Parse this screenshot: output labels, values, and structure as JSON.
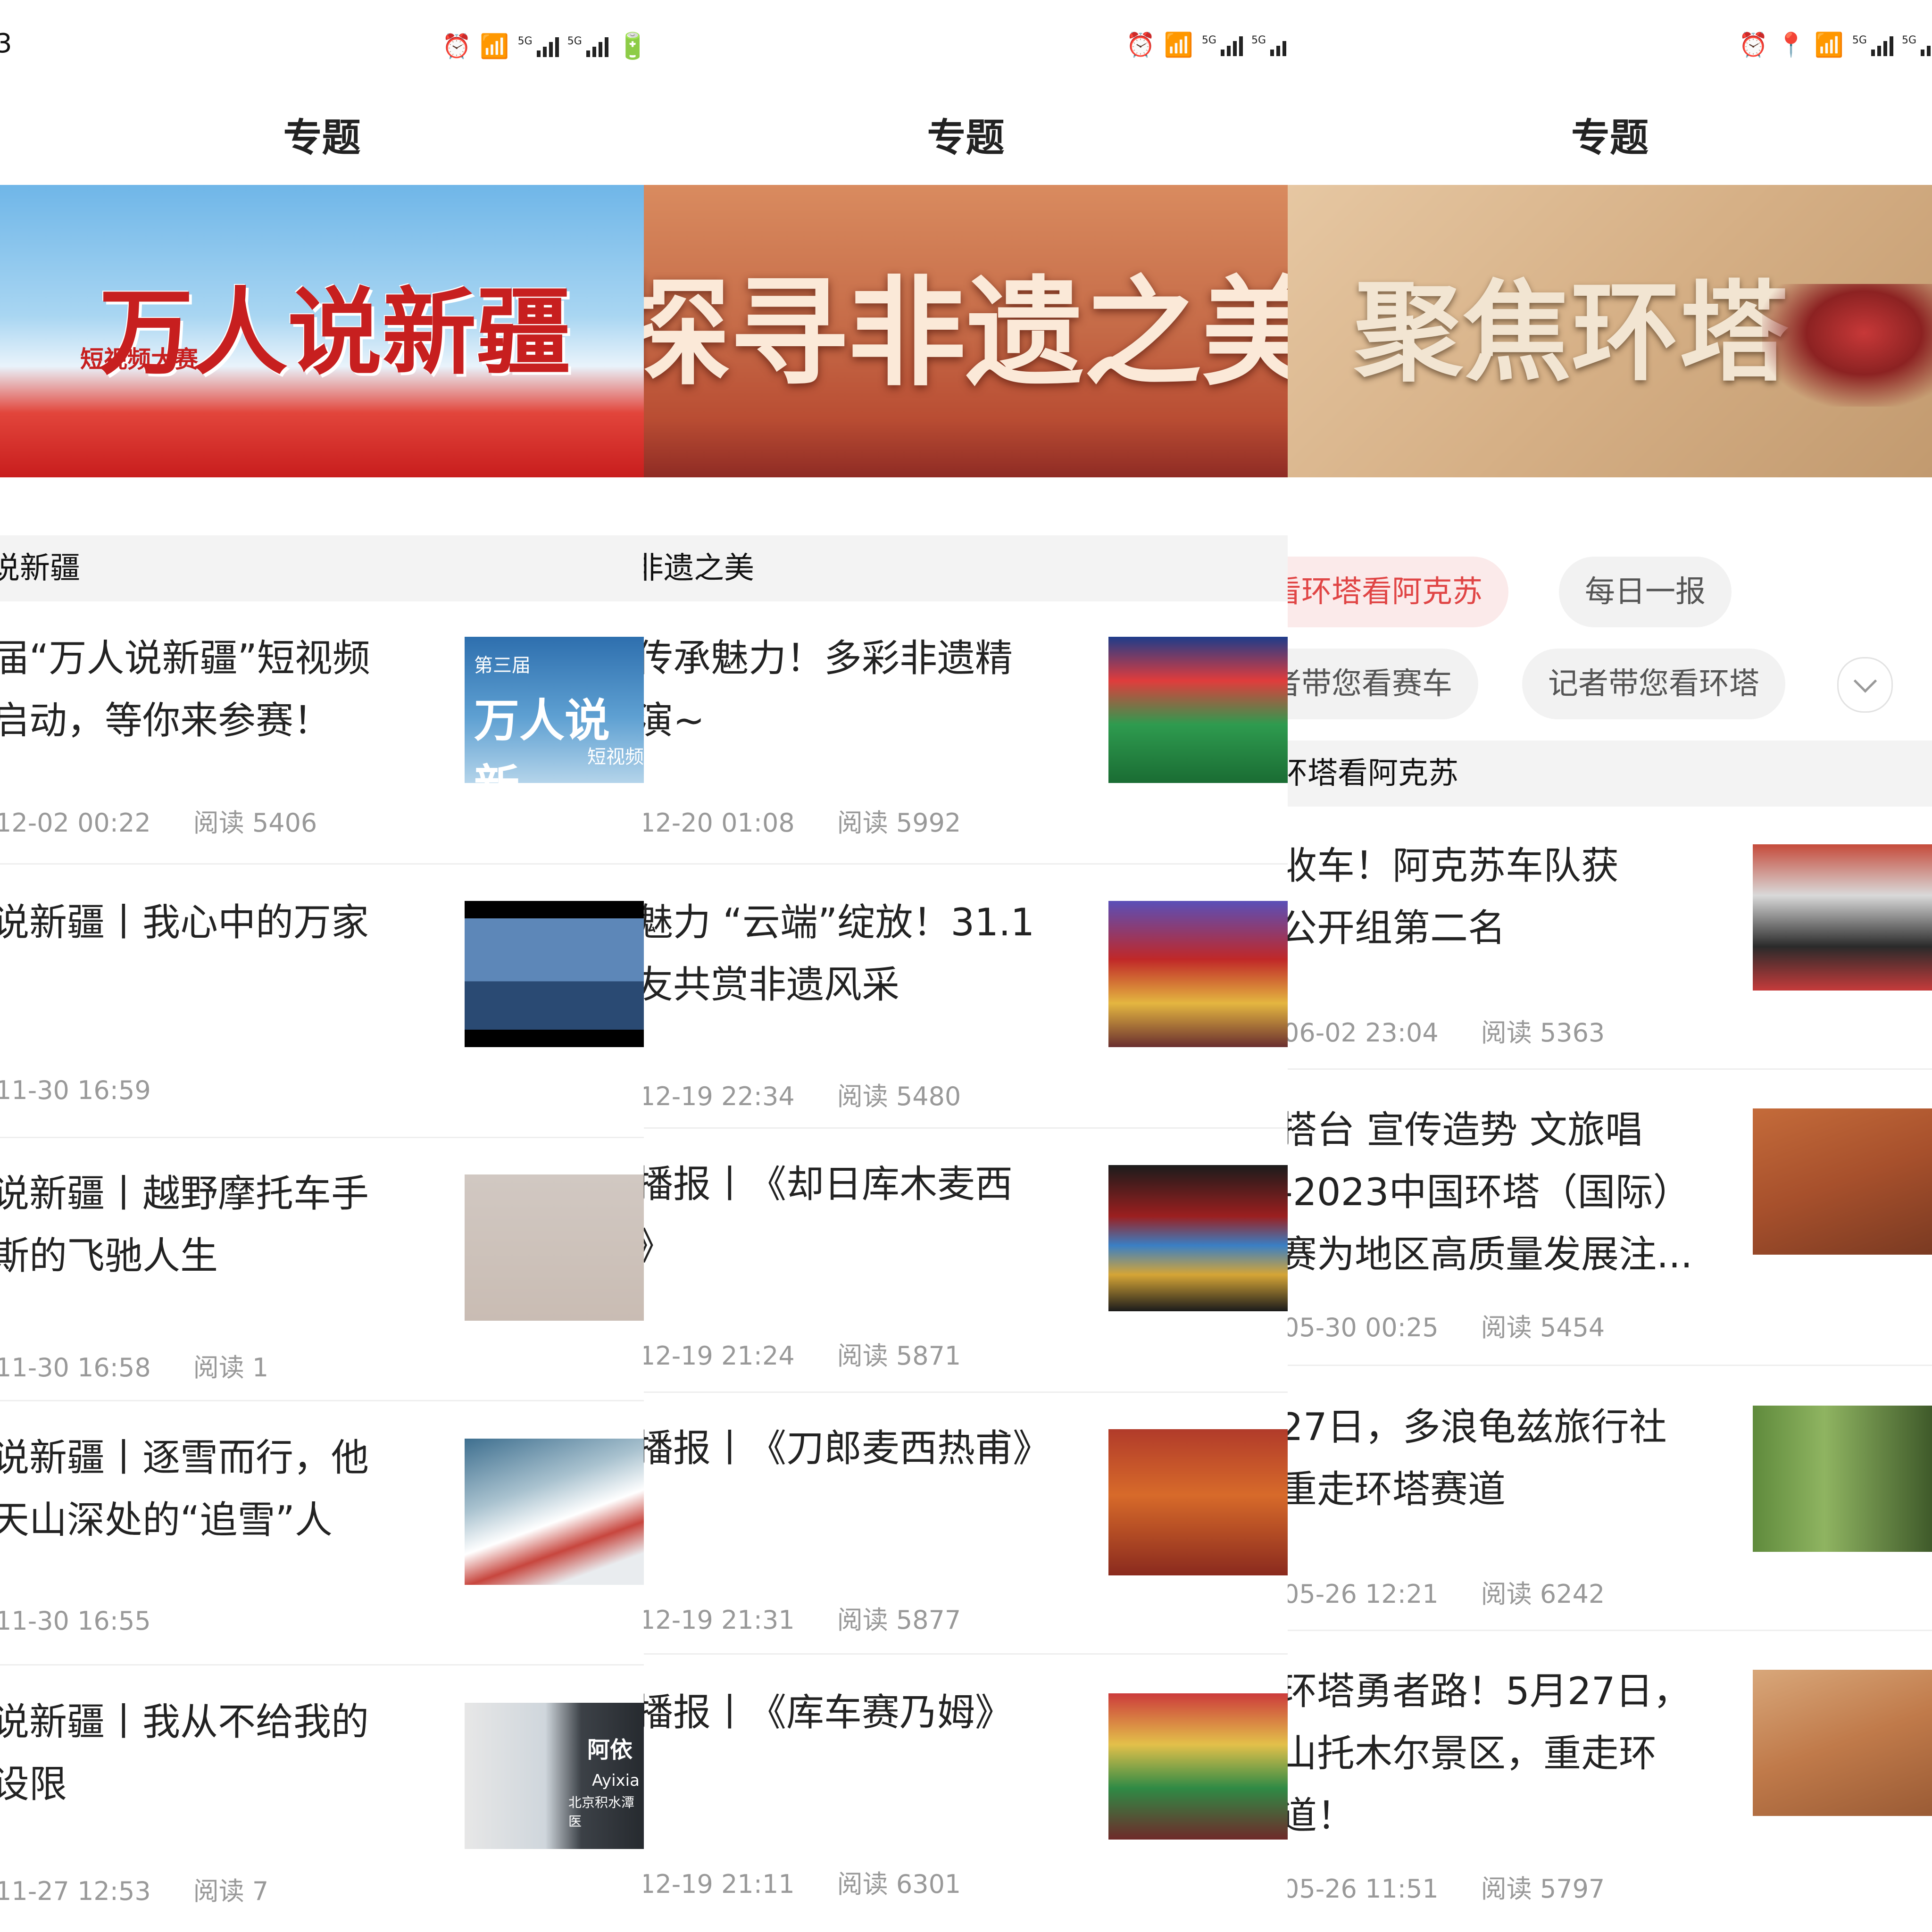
{
  "status": {
    "time": "3",
    "net": "5G"
  },
  "screens": [
    {
      "title": "专题",
      "banner": {
        "text": "万人说新疆",
        "subtext": "短视频大赛"
      },
      "section": "说新疆",
      "items": [
        {
          "l1": "届“万人说新疆”短视频",
          "l2": "启动，等你来参赛！",
          "time": "12-02 00:22",
          "reads": "阅读 5406",
          "thumb_text": "第三届",
          "thumb_text2": "万人说新",
          "thumb_text3": "短视频"
        },
        {
          "l1": "说新疆丨我心中的万家",
          "l2": "",
          "time": "11-30 16:59",
          "reads": ""
        },
        {
          "l1": "说新疆丨越野摩托车手",
          "l2": "斯的飞驰人生",
          "time": "11-30 16:58",
          "reads": "阅读 1"
        },
        {
          "l1": "说新疆丨逐雪而行，他",
          "l2": "天山深处的“追雪”人",
          "time": "11-30 16:55",
          "reads": ""
        },
        {
          "l1": "说新疆丨我从不给我的",
          "l2": "设限",
          "time": "11-27 12:53",
          "reads": "阅读 7",
          "thumb_text": "阿依",
          "thumb_text2": "Ayixia",
          "thumb_text3": "北京积水潭医"
        }
      ]
    },
    {
      "title": "专题",
      "banner": {
        "text": "探寻非遗之美"
      },
      "section": "非遗之美",
      "items": [
        {
          "l1": "传承魅力！多彩非遗精",
          "l2": "演~",
          "time": "12-20 01:08",
          "reads": "阅读 5992"
        },
        {
          "l1": "魅力 “云端”绽放！31.1",
          "l2": "友共赏非遗风采",
          "time": "12-19 22:34",
          "reads": "阅读 5480"
        },
        {
          "l1": "播报丨《却日库木麦西",
          "l2": "》",
          "time": "12-19 21:24",
          "reads": "阅读 5871"
        },
        {
          "l1": "播报丨《刀郎麦西热甫》",
          "l2": "",
          "time": "12-19 21:31",
          "reads": "阅读 5877"
        },
        {
          "l1": "播报丨《库车赛乃姆》",
          "l2": "",
          "time": "12-19 21:11",
          "reads": "阅读 6301"
        }
      ]
    },
    {
      "title": "专题",
      "banner": {
        "text": "聚焦环塔"
      },
      "chips": [
        "看环塔看阿克苏",
        "每日一报",
        "者带您看赛车",
        "记者带您看环塔"
      ],
      "section": "环塔看阿克苏",
      "items": [
        {
          "l1": "收车！阿克苏车队获",
          "l2": "公开组第二名",
          "l3": "",
          "time": "06-02 23:04",
          "reads": "阅读 5363"
        },
        {
          "l1": "搭台 宣传造势 文旅唱",
          "l2": "-2023中国环塔（国际）",
          "l3": "赛为地区高质量发展注...",
          "time": "05-30 00:25",
          "reads": "阅读 5454"
        },
        {
          "l1": "27日，多浪龟兹旅行社",
          "l2": "重走环塔赛道",
          "l3": "",
          "time": "05-26 12:21",
          "reads": "阅读 6242"
        },
        {
          "l1": "环塔勇者路！5月27日，",
          "l2": "山托木尔景区，重走环",
          "l3": "道！",
          "time": "05-26 11:51",
          "reads": "阅读 5797"
        }
      ]
    }
  ],
  "colors": {
    "accent": "#e04545",
    "section_bg": "#f3f3f3",
    "meta": "#999999"
  },
  "icons": [
    "alarm-icon",
    "location-icon",
    "wifi-icon",
    "signal-icon",
    "chevron-down-icon"
  ]
}
